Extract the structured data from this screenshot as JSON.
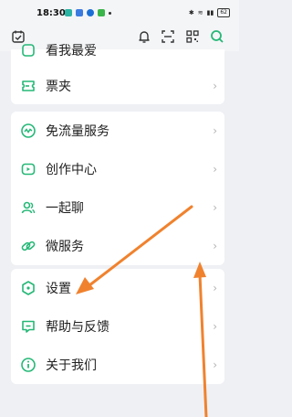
{
  "status_bar": {
    "time": "18:30",
    "battery": "62"
  },
  "colors": {
    "accent_green": "#25b877",
    "arrow_orange": "#f0822e"
  },
  "toolbar": {
    "icons": [
      "calendar-check-icon",
      "bell-icon",
      "scan-icon",
      "qr-code-icon",
      "search-icon"
    ]
  },
  "menu": {
    "partial_item": "看我最爱",
    "ticket_folder": "票夹",
    "group1": [
      {
        "label": "免流量服务",
        "icon": "data-wave-icon"
      },
      {
        "label": "创作中心",
        "icon": "creator-icon"
      },
      {
        "label": "一起聊",
        "icon": "people-icon"
      },
      {
        "label": "微服务",
        "icon": "link-icon"
      }
    ],
    "group2": [
      {
        "label": "设置",
        "icon": "hexagon-settings-icon"
      },
      {
        "label": "帮助与反馈",
        "icon": "help-chat-icon"
      },
      {
        "label": "关于我们",
        "icon": "info-icon"
      }
    ],
    "chevron": "›"
  }
}
